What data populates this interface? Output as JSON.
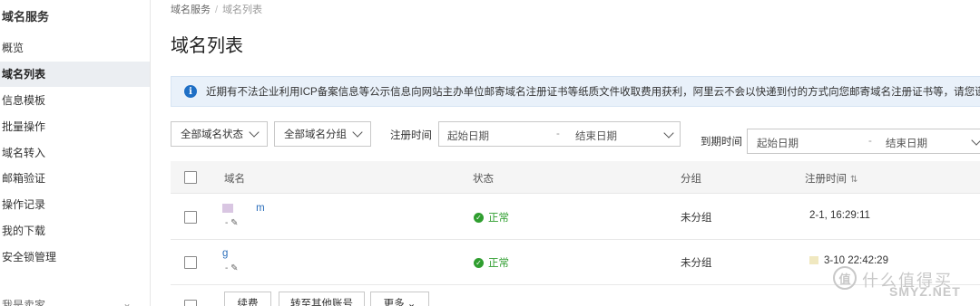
{
  "sidebar": {
    "title": "域名服务",
    "items": [
      {
        "label": "概览"
      },
      {
        "label": "域名列表",
        "active": true
      },
      {
        "label": "信息模板"
      },
      {
        "label": "批量操作"
      },
      {
        "label": "域名转入"
      },
      {
        "label": "邮箱验证"
      },
      {
        "label": "操作记录"
      },
      {
        "label": "我的下载"
      },
      {
        "label": "安全锁管理"
      }
    ],
    "more_label": "我是卖家"
  },
  "breadcrumb": {
    "root": "域名服务",
    "separator": "/",
    "current": "域名列表"
  },
  "page_title": "域名列表",
  "notice": {
    "icon": "info-icon",
    "text": "近期有不法企业利用ICP备案信息等公示信息向网站主办单位邮寄域名注册证书等纸质文件收取费用获利，阿里云不会以快递到付的方式向您邮寄域名注册证书等，请您谨慎签收！"
  },
  "filters": {
    "status": "全部域名状态",
    "group": "全部域名分组",
    "reg_time_label": "注册时间",
    "reg_start_placeholder": "起始日期",
    "reg_end_placeholder": "结束日期",
    "expire_label": "到期时间",
    "exp_start_placeholder": "起始日期",
    "exp_end_placeholder": "结束日期"
  },
  "table": {
    "columns": [
      "域名",
      "状态",
      "分组",
      "注册时间"
    ],
    "rows": [
      {
        "domain": "m",
        "domain_sub": "- ✎",
        "status": "正常",
        "group": "未分组",
        "reg_time": "2-1, 16:29:11"
      },
      {
        "domain": "g",
        "domain_sub": "- ✎",
        "status": "正常",
        "group": "未分组",
        "reg_time": "3-10 22:42:29"
      }
    ]
  },
  "bottom_buttons": {
    "renew": "续费",
    "transfer": "转至其他账号",
    "more": "更多"
  },
  "watermark": {
    "logo_char": "值",
    "text": "什么值得买",
    "site": "SMYZ.NET"
  },
  "colors": {
    "accent": "#1f6fc5",
    "status_ok": "#2f9e2f",
    "link": "#2a6ebb"
  }
}
